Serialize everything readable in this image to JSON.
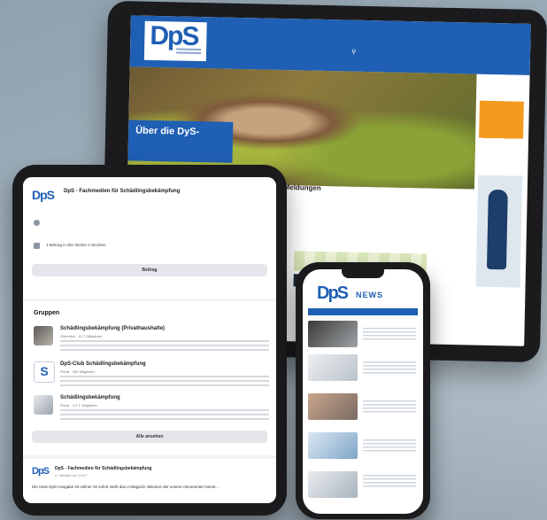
{
  "monitor": {
    "logo": "DpS",
    "nav": [
      "",
      "",
      "",
      "",
      ""
    ],
    "hero_badge": "Über die DyS-",
    "section_title": "e Meldungen",
    "news_headline": "",
    "news_date": ""
  },
  "tablet": {
    "page_name": "DpS - Fachmedien für Schädlingsbekämpfung",
    "page_logo": "DpS",
    "info_line": "",
    "posts_line": "1 Beitrag in den letzten 4 Wochen",
    "follow_button": "Beitrag",
    "groups_heading": "Gruppen",
    "groups": [
      {
        "name": "Schädlingsbekämpfung (Privathaushalte)",
        "meta": "Öffentlich · 15 T. Mitglieder"
      },
      {
        "name": "DpS-Club Schädlingsbekämpfung",
        "meta": "Privat · 354 Mitglieder"
      },
      {
        "name": "Schädlingsbekämpfung",
        "meta": "Privat · 4,5 T. Mitglieder"
      }
    ],
    "show_all_button": "Alle ansehen",
    "post": {
      "logo": "DpS",
      "title": "DpS - Fachmedien für Schädlingsbekämpfung",
      "date": "4. Oktober um 14:47",
      "body": "Die neue DpS-Ausgabe ist online! Ab sofort steht das e-Magazin inklusive der unsere Abonnenten bereit..."
    }
  },
  "phone": {
    "logo": "DpS",
    "news_label": "NEWS",
    "items": [
      {
        "headline": ""
      },
      {
        "headline": ""
      },
      {
        "headline": ""
      },
      {
        "headline": ""
      }
    ]
  },
  "colors": {
    "brand_blue": "#1f5fb4",
    "background": "#a3b3be",
    "ad_orange": "#f39a1f"
  }
}
